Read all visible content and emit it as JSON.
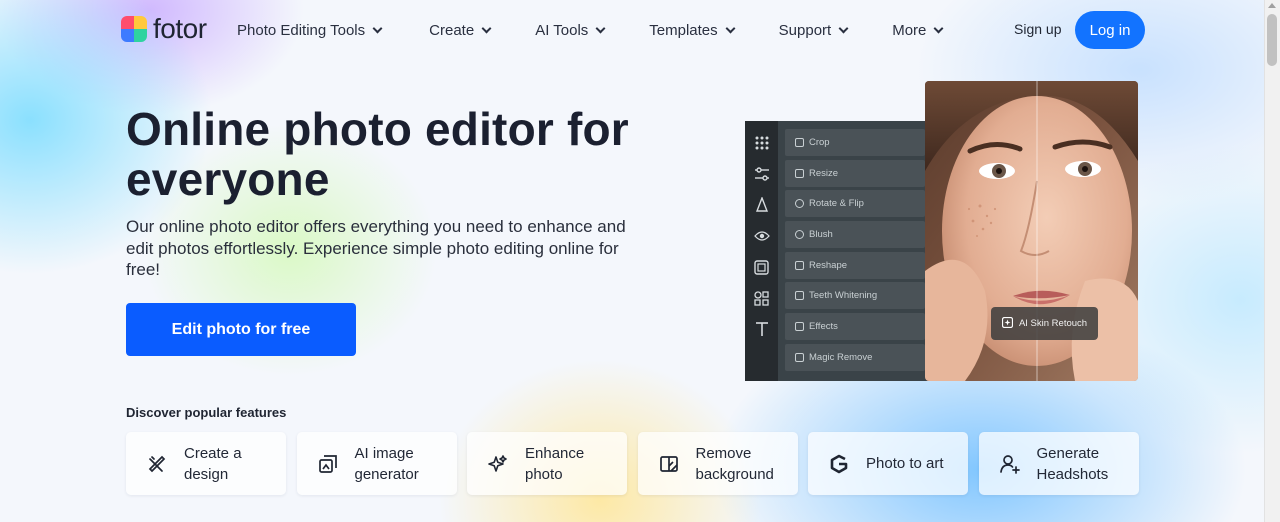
{
  "brand": {
    "name": "fotor"
  },
  "nav": {
    "items": [
      {
        "label": "Photo Editing Tools"
      },
      {
        "label": "Create"
      },
      {
        "label": "AI Tools"
      },
      {
        "label": "Templates"
      },
      {
        "label": "Support"
      },
      {
        "label": "More"
      }
    ],
    "signup_label": "Sign up",
    "login_label": "Log in"
  },
  "hero": {
    "title": "Online photo editor for everyone",
    "description": "Our online photo editor offers everything you need to enhance and edit photos effortlessly. Experience simple photo editing online for free!",
    "cta_label": "Edit photo for free"
  },
  "editor_mock": {
    "tools": [
      {
        "label": "Crop"
      },
      {
        "label": "Resize"
      },
      {
        "label": "Rotate & Flip"
      },
      {
        "label": "Blush"
      },
      {
        "label": "Reshape"
      },
      {
        "label": "Teeth Whitening"
      },
      {
        "label": "Effects"
      },
      {
        "label": "Magic Remove"
      }
    ],
    "badge_label": "AI Skin Retouch"
  },
  "features": {
    "title": "Discover popular features",
    "cards": [
      {
        "label": "Create a design",
        "icon": "pencil-ruler-icon"
      },
      {
        "label": "AI image generator",
        "icon": "ai-image-icon"
      },
      {
        "label": "Enhance photo",
        "icon": "sparkle-enhance-icon"
      },
      {
        "label": "Remove background",
        "icon": "remove-bg-icon"
      },
      {
        "label": "Photo to art",
        "icon": "art-g-icon"
      },
      {
        "label": "Generate Headshots",
        "icon": "person-plus-icon"
      }
    ]
  },
  "colors": {
    "primary": "#0a5cff",
    "login": "#1273ff",
    "text": "#1b2030"
  }
}
